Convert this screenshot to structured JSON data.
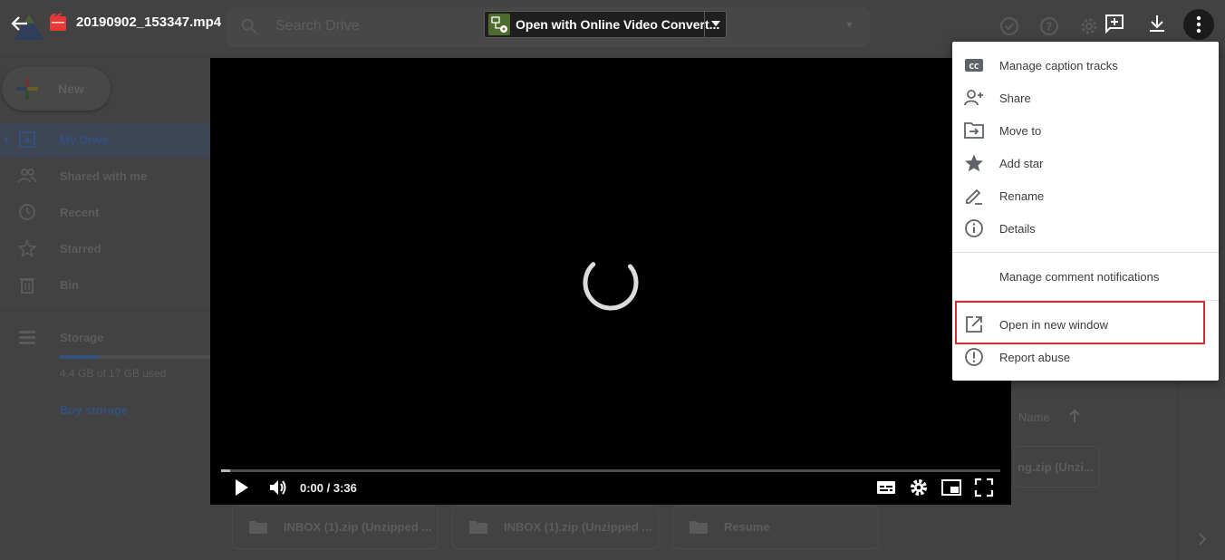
{
  "viewer": {
    "file_title": "20190902_153347.mp4",
    "open_with_label": "Open with Online Video Convert..."
  },
  "drive_background": {
    "search_placeholder": "Search Drive",
    "new_label": "New",
    "nav": [
      {
        "label": "My Drive",
        "icon": "my-drive-icon",
        "active": true
      },
      {
        "label": "Shared with me",
        "icon": "shared-icon"
      },
      {
        "label": "Recent",
        "icon": "clock-icon"
      },
      {
        "label": "Starred",
        "icon": "star-outline-icon"
      },
      {
        "label": "Bin",
        "icon": "trash-icon"
      }
    ],
    "storage": {
      "label": "Storage",
      "used_text": "4.4 GB of 17 GB used",
      "used_fraction": 0.26,
      "buy_label": "Buy storage"
    },
    "sort_label": "Name",
    "files": [
      {
        "name": "ng.zip (Unzi..."
      },
      {
        "name": "INBOX (1).zip (Unzipped ..."
      },
      {
        "name": "INBOX (1).zip (Unzipped ..."
      },
      {
        "name": "Resume"
      }
    ]
  },
  "player": {
    "state": "loading",
    "time": "0:00 / 3:36",
    "progress_fraction": 0.0
  },
  "menu": {
    "items": [
      {
        "label": "Manage caption tracks",
        "icon": "closed-caption-icon"
      },
      {
        "label": "Share",
        "icon": "add-person-icon"
      },
      {
        "label": "Move to",
        "icon": "move-to-folder-icon"
      },
      {
        "label": "Add star",
        "icon": "star-icon"
      },
      {
        "label": "Rename",
        "icon": "pencil-icon"
      },
      {
        "label": "Details",
        "icon": "info-icon"
      },
      {
        "label": "Manage comment notifications",
        "icon": ""
      },
      {
        "label": "Open in new window",
        "icon": "open-in-new-icon",
        "highlighted": true
      },
      {
        "label": "Report abuse",
        "icon": "report-icon"
      }
    ]
  },
  "colors": {
    "highlight_border": "#d32f2f",
    "menu_text": "#3c3c3c",
    "video_bg": "#000000"
  }
}
